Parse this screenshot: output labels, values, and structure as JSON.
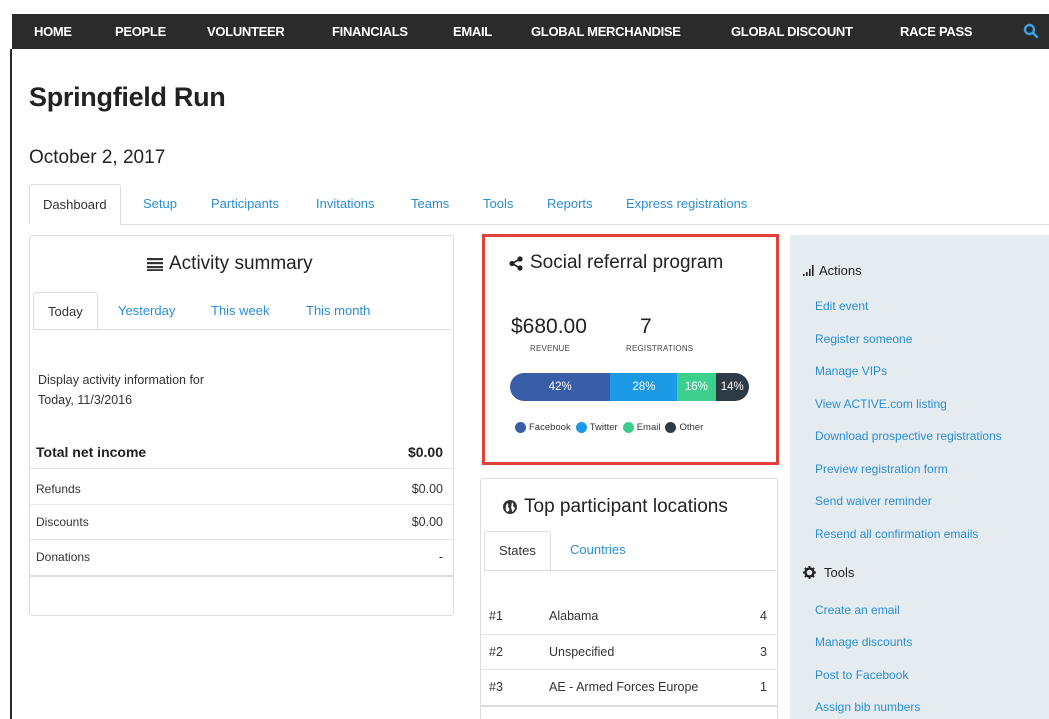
{
  "nav": {
    "items": [
      "HOME",
      "PEOPLE",
      "VOLUNTEER",
      "FINANCIALS",
      "EMAIL",
      "GLOBAL MERCHANDISE",
      "GLOBAL DISCOUNT",
      "RACE PASS"
    ],
    "search_icon": "search-icon"
  },
  "page": {
    "title": "Springfield Run",
    "date": "October 2, 2017"
  },
  "tabs": [
    "Dashboard",
    "Setup",
    "Participants",
    "Invitations",
    "Teams",
    "Tools",
    "Reports",
    "Express registrations"
  ],
  "activity": {
    "title": "Activity summary",
    "icon": "list-icon",
    "tabs": [
      "Today",
      "Yesterday",
      "This week",
      "This month"
    ],
    "display_line1": "Display activity information for",
    "display_line2": "Today, 11/3/2016",
    "total_label": "Total net income",
    "total_value": "$0.00",
    "rows": [
      {
        "label": "Refunds",
        "value": "$0.00"
      },
      {
        "label": "Discounts",
        "value": "$0.00"
      },
      {
        "label": "Donations",
        "value": "-"
      }
    ]
  },
  "social": {
    "title": "Social referral program",
    "icon": "share-icon",
    "revenue": "$680.00",
    "revenue_label": "REVENUE",
    "registrations": "7",
    "registrations_label": "REGISTRATIONS",
    "segments": [
      {
        "name": "Facebook",
        "label": "42%",
        "percent": 42,
        "color": "#3a5da8"
      },
      {
        "name": "Twitter",
        "label": "28%",
        "percent": 28,
        "color": "#1c9ae6"
      },
      {
        "name": "Email",
        "label": "16%",
        "percent": 16,
        "color": "#3ccf8e"
      },
      {
        "name": "Other",
        "label": "14%",
        "percent": 14,
        "color": "#2e3a45"
      }
    ]
  },
  "locations": {
    "title": "Top participant locations",
    "icon": "globe-icon",
    "tabs": [
      "States",
      "Countries"
    ],
    "rows": [
      {
        "rank": "#1",
        "name": "Alabama",
        "count": "4"
      },
      {
        "rank": "#2",
        "name": "Unspecified",
        "count": "3"
      },
      {
        "rank": "#3",
        "name": "AE - Armed Forces Europe",
        "count": "1"
      }
    ]
  },
  "actions": {
    "title": "Actions",
    "icon": "bar-chart-icon",
    "links": [
      "Edit event",
      "Register someone",
      "Manage VIPs",
      "View ACTIVE.com listing",
      "Download prospective registrations",
      "Preview registration form",
      "Send waiver reminder",
      "Resend all confirmation emails"
    ],
    "tools_title": "Tools",
    "tools_icon": "gear-icon",
    "tools_links": [
      "Create an email",
      "Manage discounts",
      "Post to Facebook",
      "Assign bib numbers"
    ]
  }
}
